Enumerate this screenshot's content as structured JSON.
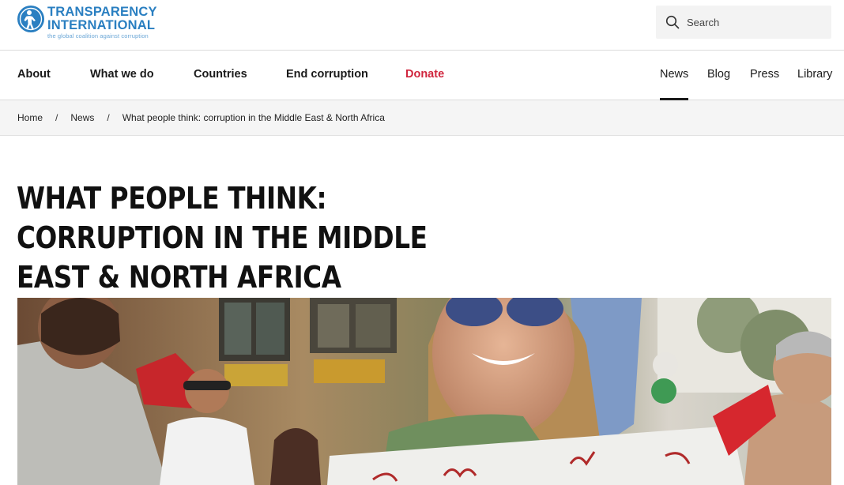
{
  "header": {
    "logo": {
      "line1": "TRANSPARENCY",
      "line2": "INTERNATIONAL",
      "tagline": "the global coalition against corruption",
      "icon": "globe-person-icon",
      "color": "#2a7fc1"
    },
    "search": {
      "placeholder": "Search",
      "icon": "search-icon"
    }
  },
  "nav": {
    "main": [
      {
        "label": "About"
      },
      {
        "label": "What we do"
      },
      {
        "label": "Countries"
      },
      {
        "label": "End corruption"
      },
      {
        "label": "Donate",
        "color": "#d0263e"
      }
    ],
    "secondary": [
      {
        "label": "News",
        "active": true
      },
      {
        "label": "Blog"
      },
      {
        "label": "Press"
      },
      {
        "label": "Library"
      }
    ]
  },
  "breadcrumb": {
    "items": [
      "Home",
      "News",
      "What people think: corruption in the Middle East & North Africa"
    ],
    "separator": "/"
  },
  "article": {
    "title": "What people think: corruption in the Middle East & North Africa",
    "hero_image": "photo of protesters at a street demonstration, smiling woman in sunglasses holding a handwritten sign"
  }
}
